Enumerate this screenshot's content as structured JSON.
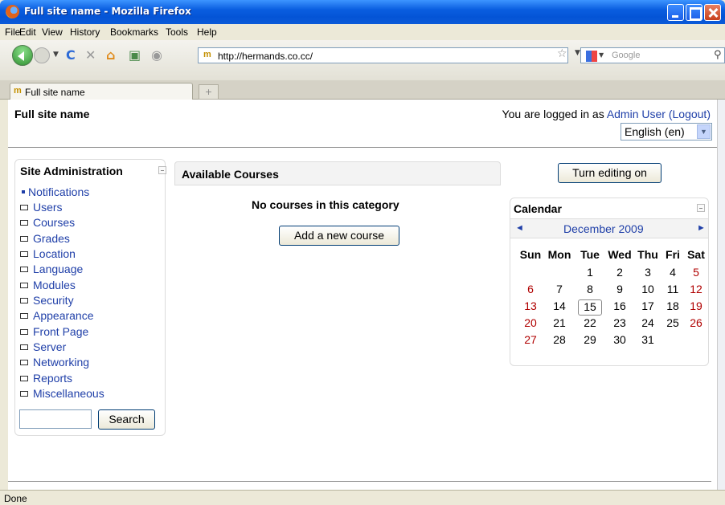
{
  "window": {
    "title": "Full site name - Mozilla Firefox"
  },
  "menu": [
    "File",
    "Edit",
    "View",
    "History",
    "Bookmarks",
    "Tools",
    "Help"
  ],
  "nav": {
    "url": "http://hermands.co.cc/",
    "search_placeholder": "Google"
  },
  "tab": {
    "label": "Full site name",
    "new_tab": "+"
  },
  "status": "Done",
  "page": {
    "site_name": "Full site name",
    "login_prefix": "You are logged in as ",
    "user": "Admin User",
    "logout": "(Logout)",
    "language": "English (en)"
  },
  "site_admin": {
    "title": "Site Administration",
    "items": [
      "Notifications",
      "Users",
      "Courses",
      "Grades",
      "Location",
      "Language",
      "Modules",
      "Security",
      "Appearance",
      "Front Page",
      "Server",
      "Networking",
      "Reports",
      "Miscellaneous"
    ],
    "search_button": "Search"
  },
  "courses": {
    "title": "Available Courses",
    "empty": "No courses in this category",
    "add_button": "Add a new course"
  },
  "turn_editing": "Turn editing on",
  "calendar": {
    "title": "Calendar",
    "month": "December 2009",
    "prev": "◄",
    "next": "►",
    "days": [
      "Sun",
      "Mon",
      "Tue",
      "Wed",
      "Thu",
      "Fri",
      "Sat"
    ],
    "first_weekday": 2,
    "num_days": 31,
    "today": 15
  }
}
